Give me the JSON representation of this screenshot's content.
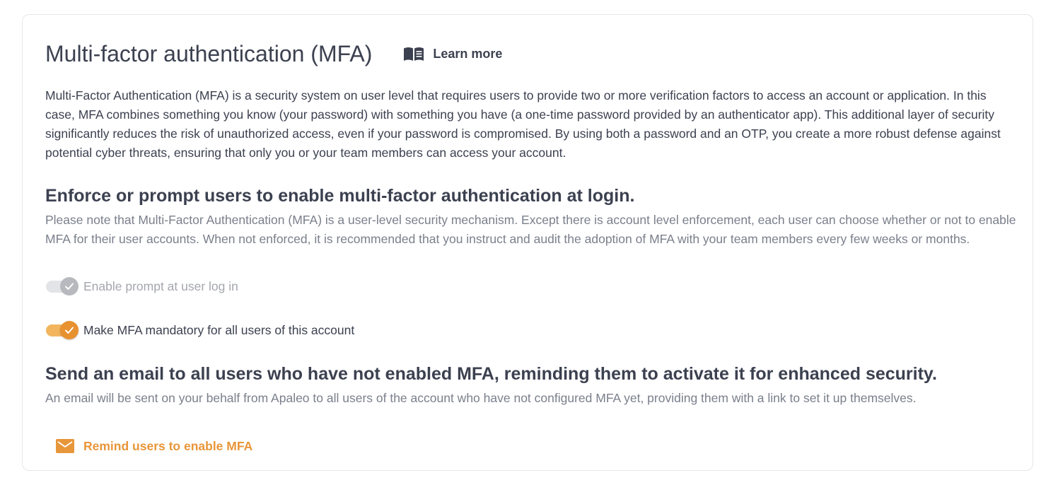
{
  "mfa": {
    "title": "Multi-factor authentication (MFA)",
    "learn_more_label": "Learn more",
    "intro": "Multi-Factor Authentication (MFA) is a security system on user level that requires users to provide two or more verification factors to access an account or application. In this case, MFA combines something you know (your password) with something you have (a one-time password provided by an authenticator app). This additional layer of security significantly reduces the risk of unauthorized access, even if your password is compromised. By using both a password and an OTP, you create a more robust defense against potential cyber threats, ensuring that only you or your team members can access your account."
  },
  "enforce": {
    "heading": "Enforce or prompt users to enable multi-factor authentication at login.",
    "note": "Please note that Multi-Factor Authentication (MFA) is a user-level security mechanism. Except there is account level enforcement, each user can choose whether or not to enable MFA for their user accounts. When not enforced, it is recommended that you instruct and audit the adoption of MFA with your team members every few weeks or months.",
    "toggles": [
      {
        "label": "Enable prompt at user log in",
        "checked": true,
        "disabled": true
      },
      {
        "label": "Make MFA mandatory for all users of this account",
        "checked": true,
        "disabled": false
      }
    ]
  },
  "reminder": {
    "heading": "Send an email to all users who have not enabled MFA, reminding them to activate it for enhanced security.",
    "note": "An email will be sent on your behalf from Apaleo to all users of the account who have not configured MFA yet, providing them with a link to set it up themselves.",
    "button_label": "Remind users to enable MFA"
  },
  "icons": {
    "learn_more": "book-icon",
    "toggle_check": "check-icon",
    "remind": "envelope-icon"
  },
  "colors": {
    "text": "#3c4150",
    "muted": "#7a7f8b",
    "accent": "#e8912f",
    "accent_light": "#f2b55e",
    "disabled_track": "#e3e4e7",
    "disabled_knob": "#b7b9be"
  }
}
